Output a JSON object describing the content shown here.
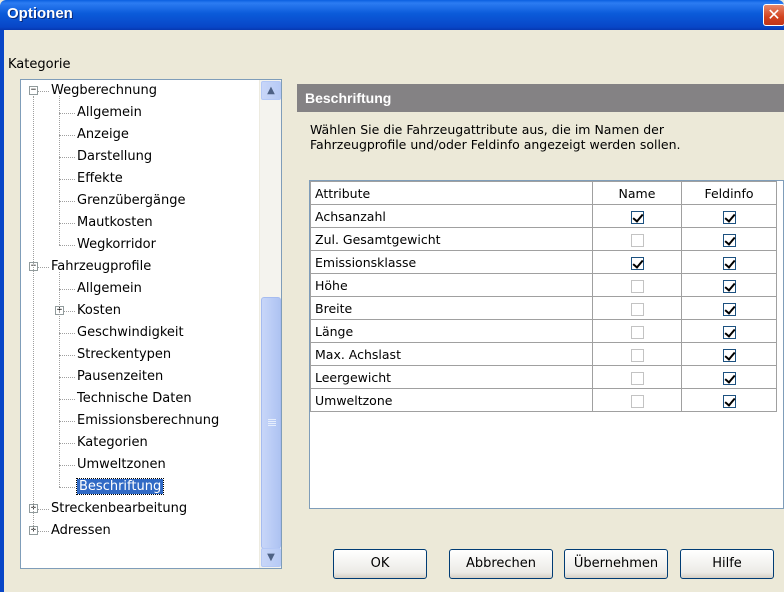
{
  "window": {
    "title": "Optionen",
    "close_glyph": "✕"
  },
  "category_label": "Kategorie",
  "tree": {
    "items": [
      {
        "label": "Wegberechnung",
        "level": 0,
        "expander": "−"
      },
      {
        "label": "Allgemein",
        "level": 1
      },
      {
        "label": "Anzeige",
        "level": 1
      },
      {
        "label": "Darstellung",
        "level": 1
      },
      {
        "label": "Effekte",
        "level": 1
      },
      {
        "label": "Grenzübergänge",
        "level": 1
      },
      {
        "label": "Mautkosten",
        "level": 1
      },
      {
        "label": "Wegkorridor",
        "level": 1
      },
      {
        "label": "Fahrzeugprofile",
        "level": 0,
        "expander": "−"
      },
      {
        "label": "Allgemein",
        "level": 1
      },
      {
        "label": "Kosten",
        "level": 1,
        "expander": "+"
      },
      {
        "label": "Geschwindigkeit",
        "level": 1
      },
      {
        "label": "Streckentypen",
        "level": 1
      },
      {
        "label": "Pausenzeiten",
        "level": 1
      },
      {
        "label": "Technische Daten",
        "level": 1
      },
      {
        "label": "Emissionsberechnung",
        "level": 1
      },
      {
        "label": "Kategorien",
        "level": 1
      },
      {
        "label": "Umweltzonen",
        "level": 1
      },
      {
        "label": "Beschriftung",
        "level": 1,
        "selected": true
      },
      {
        "label": "Streckenbearbeitung",
        "level": 0,
        "expander": "+"
      },
      {
        "label": "Adressen",
        "level": 0,
        "expander": "+"
      }
    ],
    "scroll_up_glyph": "▲",
    "scroll_down_glyph": "▼"
  },
  "panel": {
    "header": "Beschriftung",
    "description": "Wählen Sie die Fahrzeugattribute aus, die im Namen der Fahrzeugprofile und/oder Feldinfo angezeigt werden sollen."
  },
  "grid": {
    "columns": [
      "Attribute",
      "Name",
      "Feldinfo"
    ],
    "rows": [
      {
        "attribute": "Achsanzahl",
        "name": true,
        "feldinfo": true
      },
      {
        "attribute": "Zul. Gesamtgewicht",
        "name": false,
        "feldinfo": true
      },
      {
        "attribute": "Emissionsklasse",
        "name": true,
        "feldinfo": true
      },
      {
        "attribute": "Höhe",
        "name": false,
        "feldinfo": true
      },
      {
        "attribute": "Breite",
        "name": false,
        "feldinfo": true
      },
      {
        "attribute": "Länge",
        "name": false,
        "feldinfo": true
      },
      {
        "attribute": "Max. Achslast",
        "name": false,
        "feldinfo": true
      },
      {
        "attribute": "Leergewicht",
        "name": false,
        "feldinfo": true
      },
      {
        "attribute": "Umweltzone",
        "name": false,
        "feldinfo": true
      }
    ]
  },
  "buttons": {
    "ok": "OK",
    "cancel": "Abbrechen",
    "apply": "Übernehmen",
    "help": "Hilfe"
  },
  "colors": {
    "titlebar": "#0A5FE0",
    "selection": "#316AC5",
    "header_bg": "#848284",
    "window_bg": "#ECE9D8"
  }
}
